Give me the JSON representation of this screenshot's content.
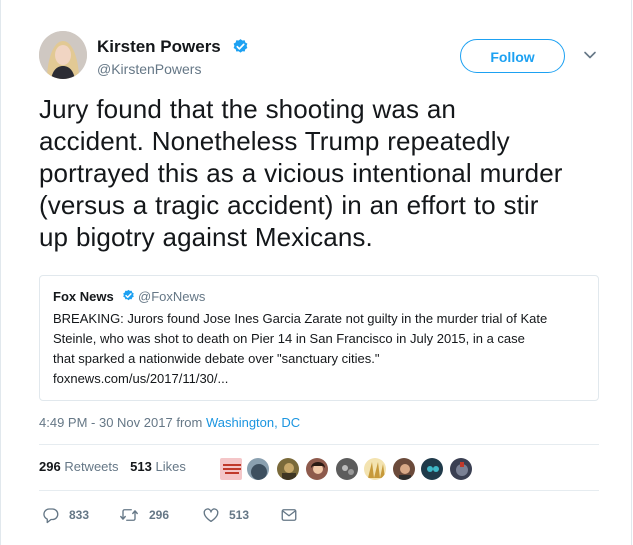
{
  "author": {
    "name": "Kirsten Powers",
    "handle": "@KirstenPowers"
  },
  "follow_label": "Follow",
  "tweet_lines": [
    "Jury found that the shooting was an",
    "accident.  Nonetheless Trump repeatedly",
    "portrayed this as a vicious intentional murder",
    "(versus a tragic accident) in an effort to stir",
    "up bigotry against Mexicans."
  ],
  "quoted": {
    "name": "Fox News",
    "handle": "@FoxNews",
    "lines": [
      "BREAKING: Jurors found Jose Ines Garcia Zarate not guilty in the murder trial of Kate",
      "Steinle, who was shot to death on Pier 14 in San Francisco in July 2015, in a case",
      "that sparked a nationwide debate over \"sanctuary cities.\"",
      "foxnews.com/us/2017/11/30/..."
    ]
  },
  "timestamp": {
    "time": "4:49 PM - 30 Nov 2017",
    "from": "from",
    "location": "Washington, DC"
  },
  "stats": {
    "retweets_count": "296",
    "retweets_label": "Retweets",
    "likes_count": "513",
    "likes_label": "Likes"
  },
  "liker_avatars": [
    {
      "icon": "sign-avatar",
      "color": "#f4c6c8"
    },
    {
      "icon": "photo-avatar",
      "color": "#4a5b6a"
    },
    {
      "icon": "photo-avatar",
      "color": "#7a6a3a"
    },
    {
      "icon": "photo-avatar",
      "color": "#8e5a4c"
    },
    {
      "icon": "photo-avatar",
      "color": "#5c5c5c"
    },
    {
      "icon": "photo-avatar",
      "color": "#c79a3a"
    },
    {
      "icon": "photo-avatar",
      "color": "#6b4a3a"
    },
    {
      "icon": "photo-avatar",
      "color": "#1f3a4a"
    },
    {
      "icon": "photo-avatar",
      "color": "#3a3f52"
    }
  ],
  "actions": {
    "reply_count": "833",
    "retweet_count": "296",
    "like_count": "513"
  },
  "colors": {
    "accent": "#1da1f2",
    "link": "#1b95e0",
    "muted": "#657786",
    "text": "#14171a",
    "border": "#e1e8ed"
  },
  "icons": [
    "verified-badge-icon",
    "chevron-down-icon",
    "reply-icon",
    "retweet-icon",
    "like-icon",
    "direct-message-icon"
  ]
}
